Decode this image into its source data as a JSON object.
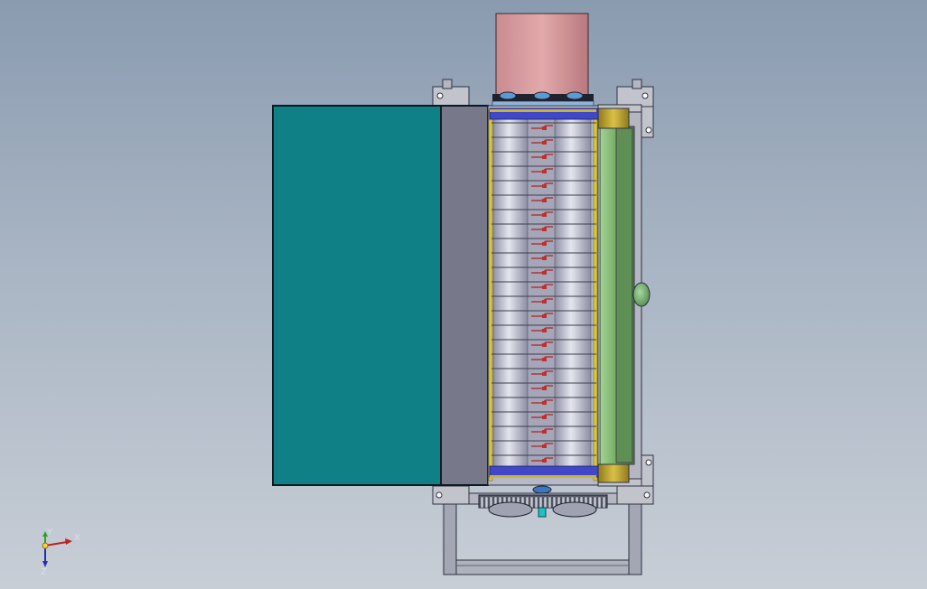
{
  "view": {
    "colors": {
      "background_top": "#8a9bb0",
      "background_bottom": "#c8ced6",
      "hopper": "#0f8186",
      "guard": "#77788a",
      "shaft_light": "#d6d8e2",
      "shaft_dark": "#9b9cb0",
      "motor": "#d49a9c",
      "gear_housing": "#7cb36b",
      "frame": "#5b6170",
      "brass": "#b8a030",
      "flange_blue": "#2e36c8",
      "blade_red": "#b02020"
    }
  },
  "triad": {
    "x_label": "X",
    "y_label": "Y",
    "z_label": "Z",
    "icons": [
      "axis-x-arrow-icon",
      "axis-y-arrow-icon",
      "axis-z-arrow-icon"
    ]
  }
}
